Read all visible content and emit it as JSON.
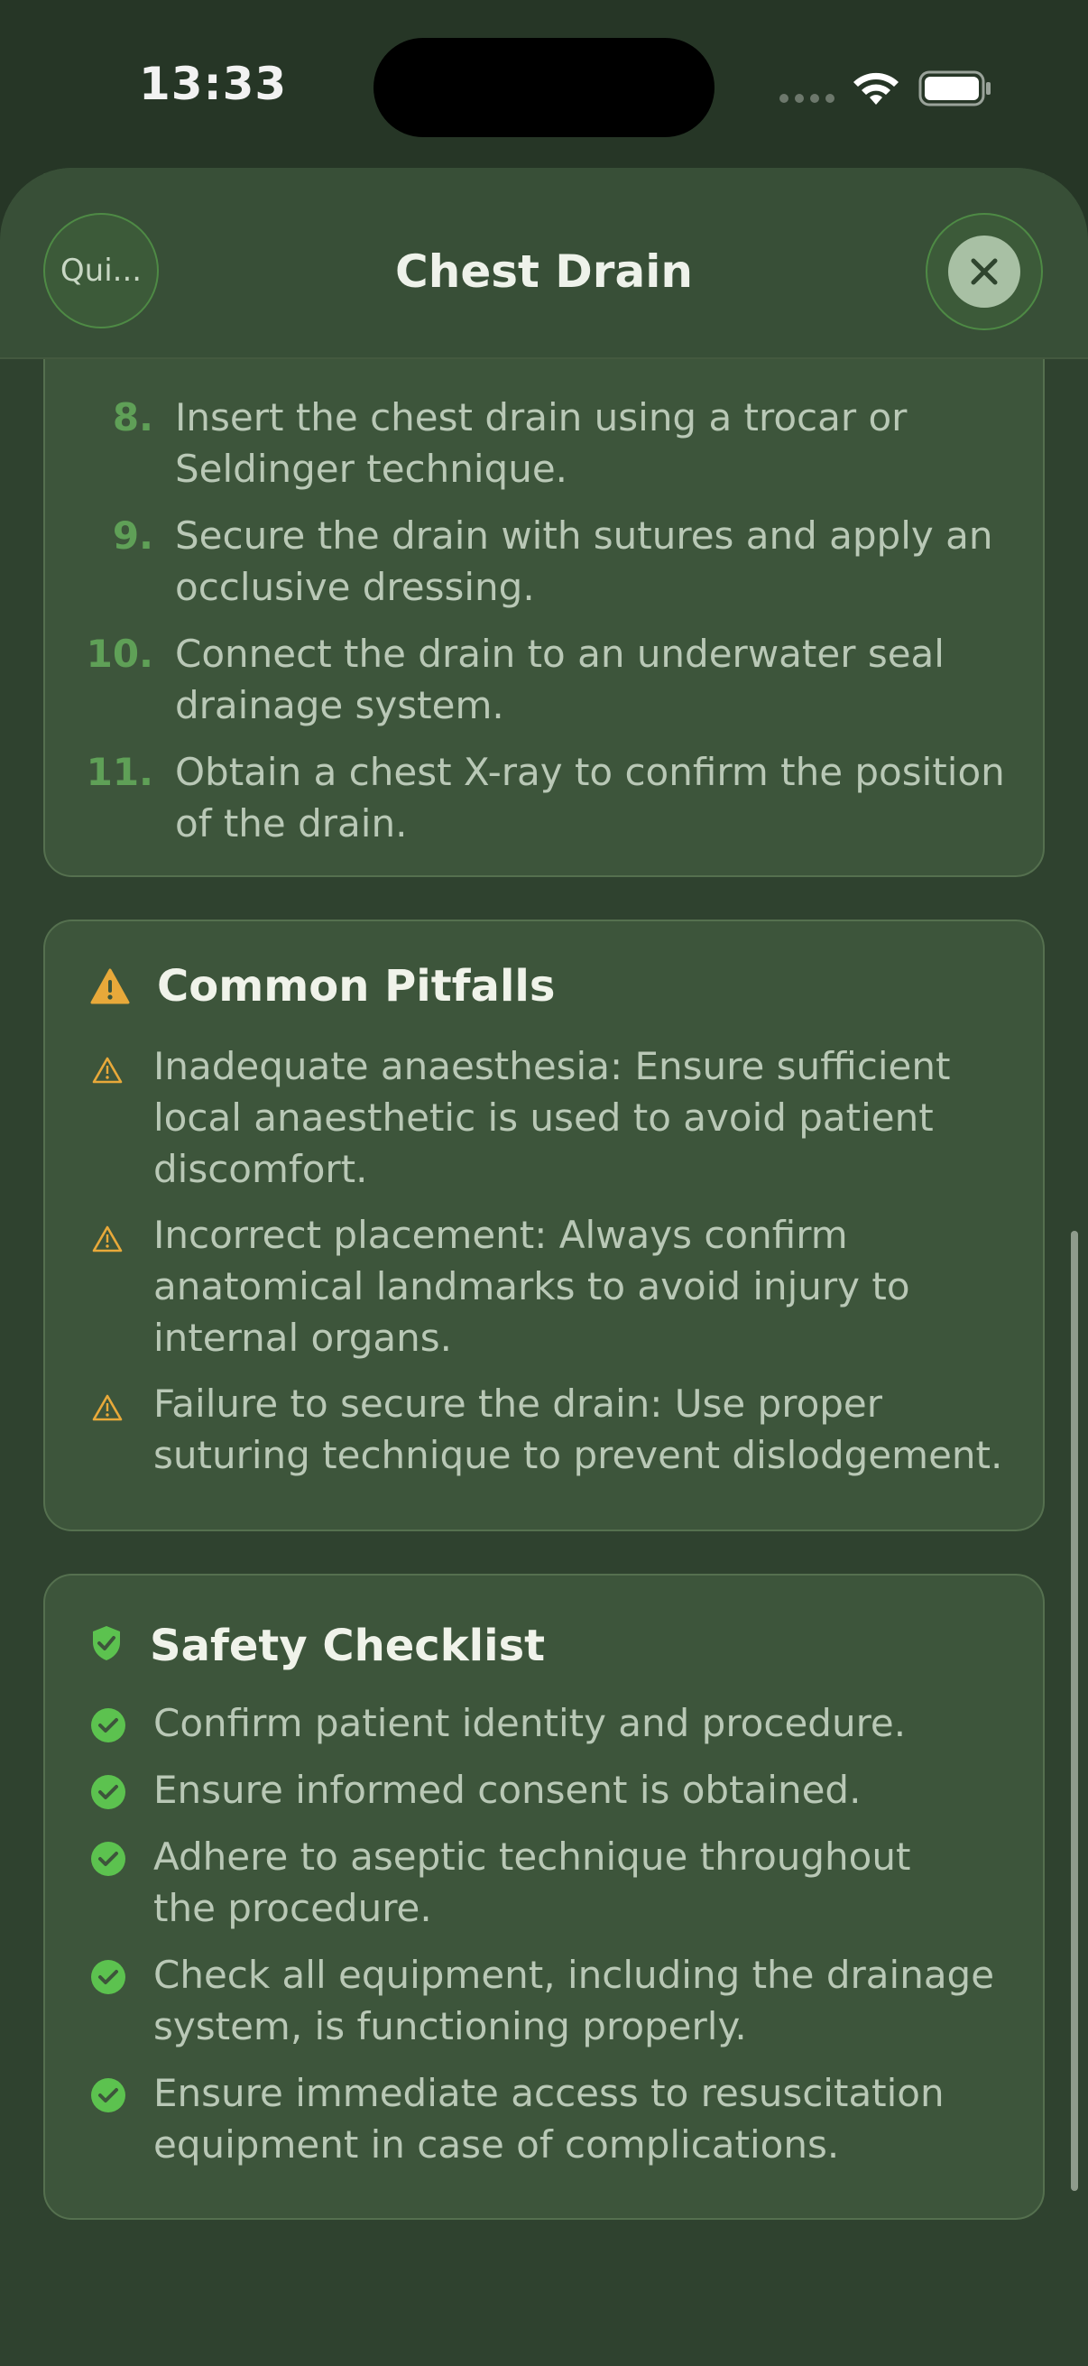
{
  "status_bar": {
    "time": "13:33"
  },
  "header": {
    "quick_label": "Qui...",
    "title": "Chest Drain"
  },
  "steps": [
    {
      "number": "8.",
      "lines": [
        "Insert the chest drain using a trocar or",
        "Seldinger technique."
      ]
    },
    {
      "number": "9.",
      "lines": [
        "Secure the drain with sutures and apply an",
        "occlusive dressing."
      ]
    },
    {
      "number": "10.",
      "lines": [
        "Connect the drain to an underwater seal",
        "drainage system."
      ]
    },
    {
      "number": "11.",
      "lines": [
        "Obtain a chest X-ray to confirm the position",
        "of the drain."
      ]
    }
  ],
  "pitfalls": {
    "title": "Common Pitfalls",
    "items": [
      {
        "lines": [
          "Inadequate anaesthesia: Ensure sufficient",
          "local anaesthetic is used to avoid patient",
          "discomfort."
        ]
      },
      {
        "lines": [
          "Incorrect placement: Always confirm",
          "anatomical landmarks to avoid injury to",
          "internal organs."
        ]
      },
      {
        "lines": [
          "Failure to secure the drain: Use proper",
          "suturing technique to prevent dislodgement."
        ]
      }
    ]
  },
  "checklist": {
    "title": "Safety Checklist",
    "items": [
      {
        "lines": [
          "Confirm patient identity and procedure."
        ]
      },
      {
        "lines": [
          "Ensure informed consent is obtained."
        ]
      },
      {
        "lines": [
          "Adhere to aseptic technique throughout",
          "the procedure."
        ]
      },
      {
        "lines": [
          "Check all equipment, including the drainage",
          "system, is functioning properly."
        ]
      },
      {
        "lines": [
          "Ensure immediate access to resuscitation",
          "equipment in case of complications."
        ]
      }
    ]
  },
  "colors": {
    "accent_green": "#5fa057",
    "warning_amber": "#e8a93a",
    "check_green": "#5cc24f"
  }
}
